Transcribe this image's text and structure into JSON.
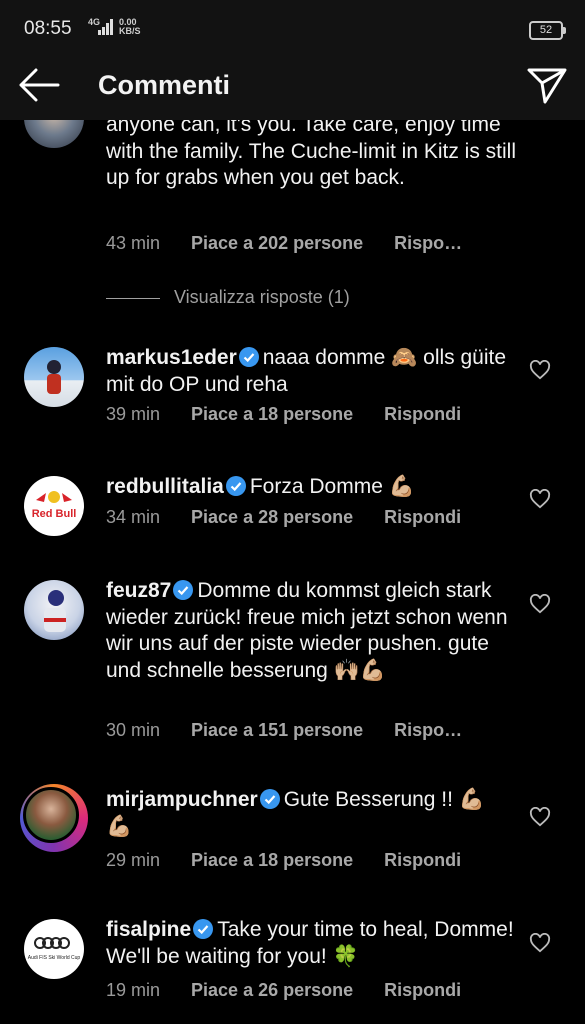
{
  "status_bar": {
    "time": "08:55",
    "network": "4G",
    "speed_value": "0.00",
    "speed_unit": "KB/S",
    "battery": "52"
  },
  "header": {
    "title": "Commenti"
  },
  "replies_link": "Visualizza risposte (1)",
  "comments": [
    {
      "user": "",
      "text": "anyone can, it's you. Take care, enjoy time with the family. The Cuche-limit in Kitz is still up for grabs when you get back.",
      "time": "43 min",
      "likes": "Piace a 202 persone",
      "reply": "Rispo…"
    },
    {
      "user": "markus1eder",
      "text": "naaa domme 🙈 olls güite mit do OP und reha",
      "time": "39 min",
      "likes": "Piace a 18 persone",
      "reply": "Rispondi"
    },
    {
      "user": "redbullitalia",
      "text": "Forza Domme 💪🏼",
      "time": "34 min",
      "likes": "Piace a 28 persone",
      "reply": "Rispondi"
    },
    {
      "user": "feuz87",
      "text": "Domme du kommst gleich stark wieder zurück! freue mich jetzt schon wenn wir uns auf der piste wieder pushen. gute und schnelle besserung 🙌🏼💪🏼",
      "time": "30 min",
      "likes": "Piace a 151 persone",
      "reply": "Rispo…"
    },
    {
      "user": "mirjampuchner",
      "text": "Gute Besserung !! 💪🏼💪🏼",
      "time": "29 min",
      "likes": "Piace a 18 persone",
      "reply": "Rispondi"
    },
    {
      "user": "fisalpine",
      "text": "Take your time to heal, Domme! We'll be waiting for you! 🍀",
      "time": "19 min",
      "likes": "Piace a 26 persone",
      "reply": "Rispondi"
    }
  ],
  "avatars": {
    "redbull_text": "Red Bull",
    "fis_text": "Audi FIS Ski World Cup"
  },
  "colors": {
    "background": "#000000",
    "bar": "#121212",
    "verified": "#3897f0",
    "meta": "#9a9a9a"
  }
}
